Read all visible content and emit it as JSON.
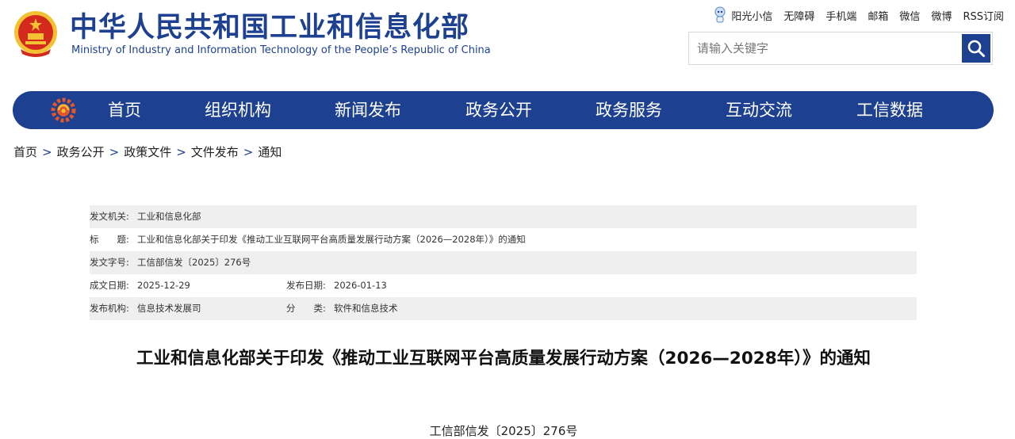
{
  "header": {
    "title_cn": "中华人民共和国工业和信息化部",
    "title_en": "Ministry of Industry and Information Technology of the People’s Republic of China",
    "emblem_icon": "national-emblem-icon"
  },
  "toplinks": [
    "阳光小信",
    "无障碍",
    "手机端",
    "邮箱",
    "微信",
    "微博",
    "RSS订阅"
  ],
  "search": {
    "placeholder": "请输入关键字",
    "button_icon": "search-icon"
  },
  "nav": {
    "logo_icon": "miit-gear-logo-icon",
    "items": [
      "首页",
      "组织机构",
      "新闻发布",
      "政务公开",
      "政务服务",
      "互动交流",
      "工信数据"
    ]
  },
  "breadcrumb": [
    "首页",
    "政务公开",
    "政策文件",
    "文件发布",
    "通知"
  ],
  "breadcrumb_sep": ">",
  "meta": {
    "issuer_label": "发文机关:",
    "issuer": "工业和信息化部",
    "title_label": "标　　题:",
    "title": "工业和信息化部关于印发《推动工业互联网平台高质量发展行动方案（2026—2028年）》的通知",
    "docno_label": "发文字号:",
    "docno": "工信部信发〔2025〕276号",
    "created_label": "成文日期:",
    "created": "2025-12-29",
    "published_label": "发布日期:",
    "published": "2026-01-13",
    "org_label": "发布机构:",
    "org": "信息技术发展司",
    "category_label": "分　　类:",
    "category": "软件和信息技术"
  },
  "document": {
    "title": "工业和信息化部关于印发《推动工业互联网平台高质量发展行动方案（2026—2028年）》的通知",
    "number": "工信部信发〔2025〕276号"
  },
  "colors": {
    "brand_blue": "#1d4190",
    "meta_gray": "#efefef",
    "emblem_red": "#d42a1e",
    "emblem_gold": "#f3c233"
  }
}
